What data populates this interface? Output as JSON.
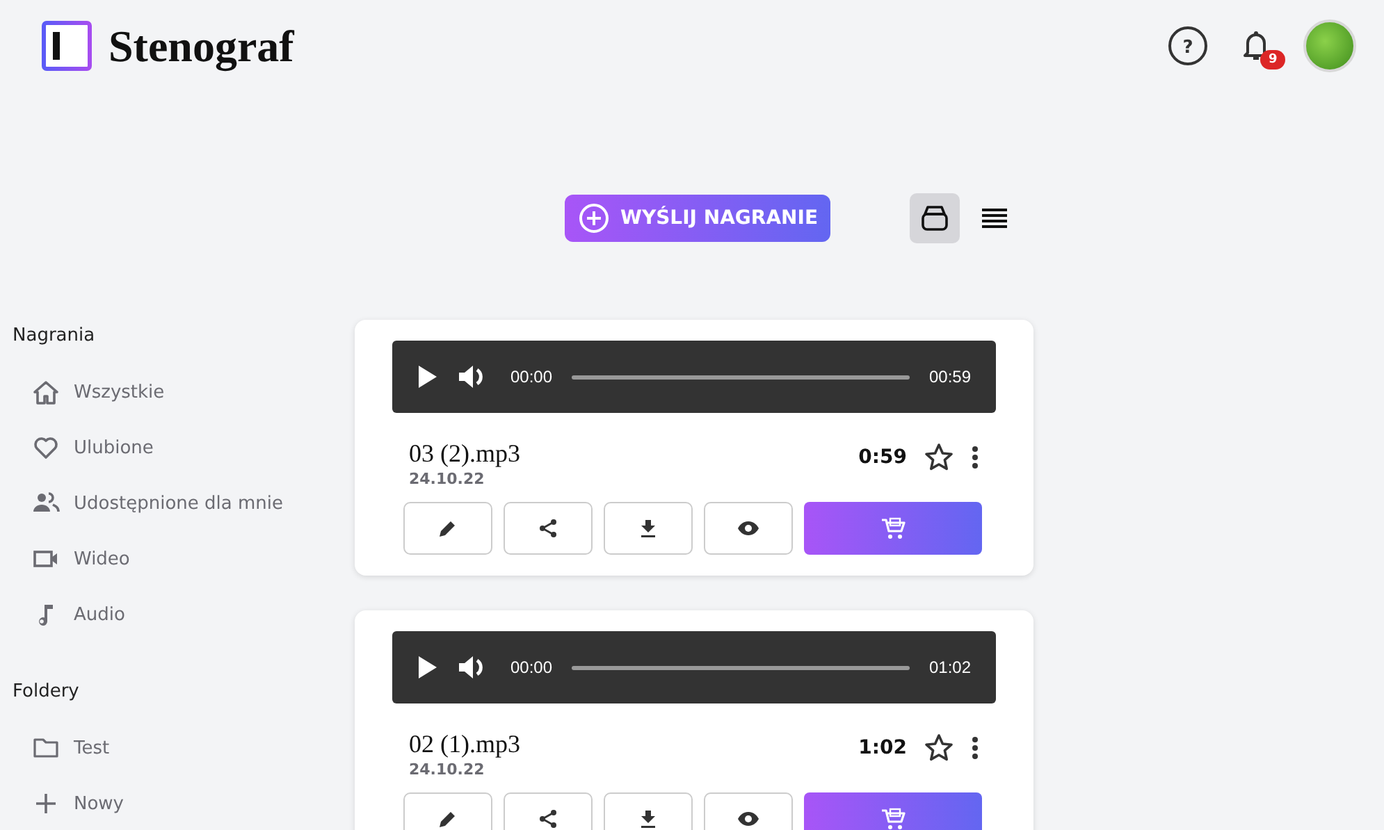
{
  "header": {
    "brand": "Stenograf",
    "help_label": "?",
    "notifications_badge": "9"
  },
  "toolbar": {
    "upload_button": "WYŚLIJ NAGRANIE",
    "views": [
      {
        "kind": "cards",
        "selected": true
      },
      {
        "kind": "list",
        "selected": false
      }
    ]
  },
  "sidebar": {
    "sections": [
      {
        "title": "Nagrania",
        "items": [
          {
            "kind": "home",
            "label": "Wszystkie"
          },
          {
            "kind": "heart",
            "label": "Ulubione"
          },
          {
            "kind": "people",
            "label": "Udostępnione dla mnie"
          },
          {
            "kind": "video",
            "label": "Wideo"
          },
          {
            "kind": "note",
            "label": "Audio"
          }
        ]
      },
      {
        "title": "Foldery",
        "items": [
          {
            "kind": "folder",
            "label": "Test"
          },
          {
            "kind": "add",
            "label": "Nowy"
          }
        ]
      }
    ]
  },
  "recordings": [
    {
      "file": "03 (2).mp3",
      "date": "24.10.22",
      "duration": "0:59",
      "player_current": "00:00",
      "player_total": "00:59",
      "favorite": false
    },
    {
      "file": "02 (1).mp3",
      "date": "24.10.22",
      "duration": "1:02",
      "player_current": "00:00",
      "player_total": "01:02",
      "favorite": false
    }
  ]
}
